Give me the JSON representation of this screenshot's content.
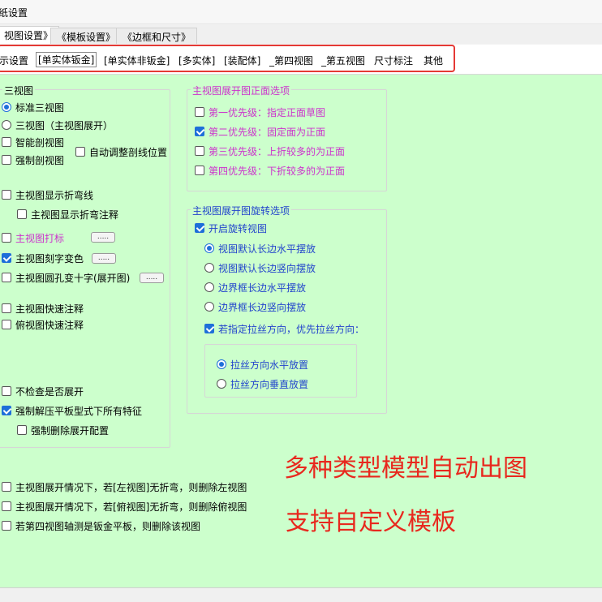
{
  "window": {
    "title": "纸设置"
  },
  "tabs": [
    {
      "label": "视图设置》"
    },
    {
      "label": "《模板设置》"
    },
    {
      "label": "《边框和尺寸》"
    }
  ],
  "subtabs": [
    {
      "label": "示设置"
    },
    {
      "label": "[单实体钣金]"
    },
    {
      "label": "[单实体非钣金]"
    },
    {
      "label": "[多实体]"
    },
    {
      "label": "[装配体]"
    },
    {
      "label": "_第四视图"
    },
    {
      "label": "_第五视图"
    },
    {
      "label": "尺寸标注"
    },
    {
      "label": "其他"
    }
  ],
  "left": {
    "group_title": "三视图",
    "standard_views": "标准三视图",
    "three_views_unfold": "三视图（主视图展开）",
    "smart_section": "智能剖视图",
    "force_section": "强制剖视图",
    "auto_adjust_section": "自动调整剖线位置",
    "show_bend_lines": "主视图显示折弯线",
    "show_bend_notes": "主视图显示折弯注释",
    "main_marking": "主视图打标",
    "main_engrave_color": "主视图刻字变色",
    "main_hole_cross": "主视图圆孔变十字(展开图)",
    "main_quick_note": "主视图快速注释",
    "top_quick_note": "俯视图快速注释",
    "no_check_unfold": "不检查是否展开",
    "force_flatten": "强制解压平板型式下所有特征",
    "force_delete_flat": "强制删除展开配置",
    "dots": "....."
  },
  "bottom_options": [
    "主视图展开情况下，若[左视图]无折弯，则删除左视图",
    "主视图展开情况下，若[俯视图]无折弯，则删除俯视图",
    "若第四视图轴测是钣金平板，则删除该视图"
  ],
  "front_face": {
    "group_title": "主视图展开图正面选项",
    "p1": "第一优先级：指定正面草图",
    "p2": "第二优先级：固定面为正面",
    "p3": "第三优先级：上折较多的为正面",
    "p4": "第四优先级：下折较多的为正面"
  },
  "rotation": {
    "group_title": "主视图展开图旋转选项",
    "enable": "开启旋转视图",
    "r1": "视图默认长边水平摆放",
    "r2": "视图默认长边竖向摆放",
    "r3": "边界框长边水平摆放",
    "r4": "边界框长边竖向摆放",
    "grain_priority": "若指定拉丝方向，优先拉丝方向：",
    "grain_h": "拉丝方向水平放置",
    "grain_v": "拉丝方向垂直放置"
  },
  "promo": {
    "line1": "多种类型模型自动出图",
    "line2": "支持自定义模板"
  },
  "colors": {
    "panel_bg": "#ccffcc",
    "accent": "#1e6fd9",
    "highlight": "#e53935",
    "purple_text": "#cc33cc",
    "blue_text": "#2244cc"
  }
}
